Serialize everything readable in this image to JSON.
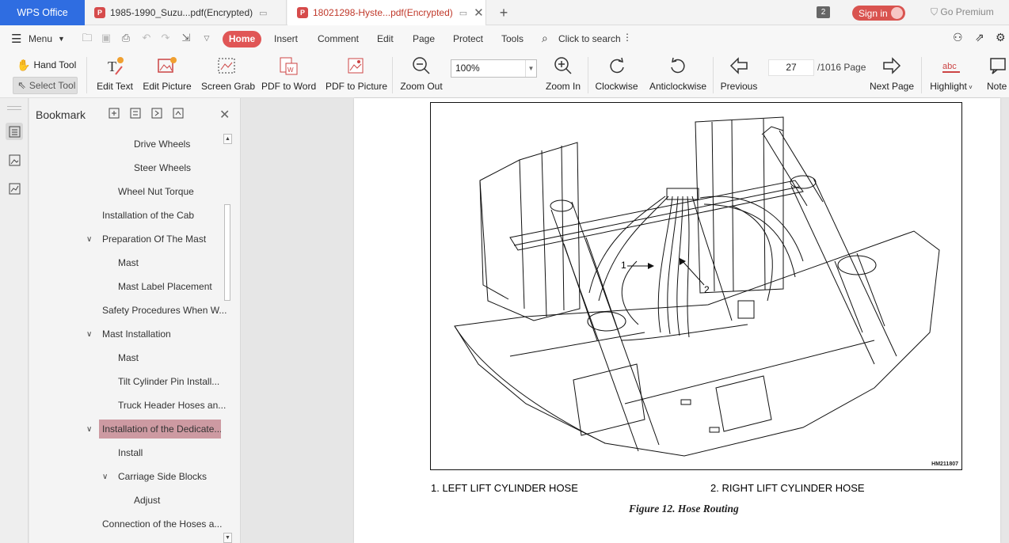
{
  "tabs": {
    "wps": "WPS Office",
    "doc1": "1985-1990_Suzu...pdf(Encrypted)",
    "doc2": "18021298-Hyste...pdf(Encrypted)",
    "window_count": "2",
    "signin": "Sign in",
    "premium": "Go Premium"
  },
  "menu": {
    "menu_label": "Menu",
    "items": [
      "Home",
      "Insert",
      "Comment",
      "Edit",
      "Page",
      "Protect",
      "Tools"
    ],
    "search": "Click to search"
  },
  "toolbar": {
    "hand": "Hand Tool",
    "select": "Select Tool",
    "edit_text": "Edit Text",
    "edit_picture": "Edit Picture",
    "screen_grab": "Screen Grab",
    "pdf_word": "PDF to Word",
    "pdf_picture": "PDF to Picture",
    "zoom_out": "Zoom Out",
    "zoom_value": "100%",
    "zoom_in": "Zoom In",
    "clockwise": "Clockwise",
    "anticlockwise": "Anticlockwise",
    "previous": "Previous",
    "page_current": "27",
    "page_total": "/1016 Page",
    "next": "Next Page",
    "highlight": "Highlight",
    "note": "Note"
  },
  "bookmark": {
    "title": "Bookmark",
    "items": [
      {
        "label": "Drive Wheels"
      },
      {
        "label": "Steer Wheels"
      },
      {
        "label": "Wheel Nut Torque"
      },
      {
        "label": "Installation of the Cab"
      },
      {
        "label": "Preparation Of The Mast"
      },
      {
        "label": "Mast"
      },
      {
        "label": "Mast Label Placement"
      },
      {
        "label": "Safety Procedures When W..."
      },
      {
        "label": "Mast Installation"
      },
      {
        "label": "Mast"
      },
      {
        "label": "Tilt Cylinder Pin Install..."
      },
      {
        "label": "Truck Header Hoses an..."
      },
      {
        "label": "Installation of the Dedicate..."
      },
      {
        "label": "Install"
      },
      {
        "label": "Carriage Side Blocks"
      },
      {
        "label": "Adjust"
      },
      {
        "label": "Connection of the Hoses a..."
      }
    ]
  },
  "document": {
    "figure_code": "HM211807",
    "callout_1": "1",
    "callout_2": "2",
    "caption_1": "1.   LEFT LIFT CYLINDER HOSE",
    "caption_2": "2.   RIGHT LIFT CYLINDER HOSE",
    "figure_title": "Figure 12.  Hose Routing"
  }
}
